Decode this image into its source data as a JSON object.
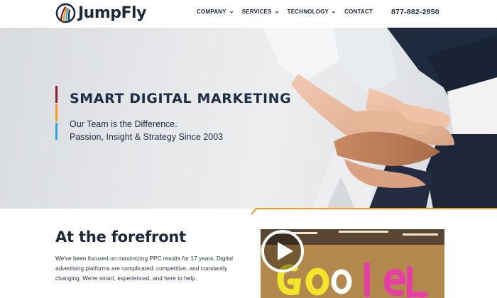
{
  "brand": {
    "name": "JumpFly"
  },
  "nav": {
    "items": [
      {
        "label": "COMPANY",
        "dropdown": true
      },
      {
        "label": "SERVICES",
        "dropdown": true
      },
      {
        "label": "TECHNOLOGY",
        "dropdown": true
      },
      {
        "label": "CONTACT",
        "dropdown": false
      }
    ]
  },
  "phone": "877-882-2850",
  "hero": {
    "title": "SMART DIGITAL MARKETING",
    "line1": "Our Team is the Difference.",
    "line2": "Passion, Insight & Strategy Since 2003",
    "accent_colors": [
      "#8e1b2a",
      "#f39a1e",
      "#2aa6df"
    ]
  },
  "section": {
    "title": "At the forefront",
    "body": "We've been focused on maximizing PPC results for 17 years. Digital advertising platforms are complicated, competitive, and constantly changing. We're smart, experienced, and here to help."
  },
  "colors": {
    "divider_orange": "#f39a1e",
    "text_navy": "#1d2838"
  },
  "icons": {
    "chevron": "chevron-down-icon",
    "play": "play-icon"
  }
}
